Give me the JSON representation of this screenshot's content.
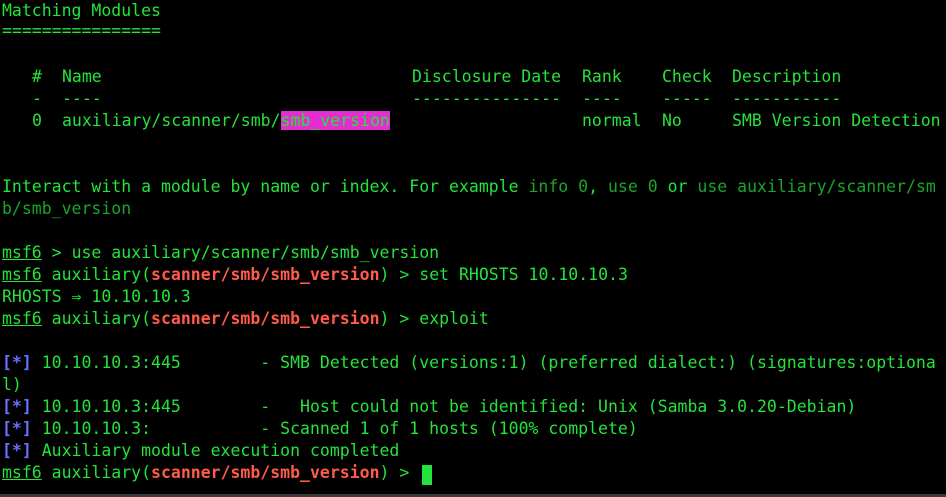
{
  "header": {
    "title": "Matching Modules",
    "underline": "================"
  },
  "table": {
    "headers": [
      "#",
      "Name",
      "Disclosure Date",
      "Rank",
      "Check",
      "Description"
    ],
    "underlines": [
      "-",
      "----",
      "---------------",
      "----",
      "-----",
      "-----------"
    ],
    "rows": [
      {
        "index": "0",
        "name_prefix": "auxiliary/scanner/smb/",
        "name_match": "smb_version",
        "date": "",
        "rank": "normal",
        "check": "No",
        "description": "SMB Version Detection"
      }
    ]
  },
  "hint": {
    "line1_a": "Interact with a module by name or index. For example ",
    "line1_b": "info 0",
    "line1_c": ", ",
    "line1_d": "use 0",
    "line1_e": " or ",
    "line1_f": "use auxiliary/scanner/sm",
    "line2": "b/smb_version"
  },
  "commands": [
    {
      "prompt": "msf6",
      "module": "",
      "command": "use auxiliary/scanner/smb/smb_version"
    },
    {
      "prompt": "msf6",
      "module": "scanner/smb/smb_version",
      "command": "set RHOSTS 10.10.10.3"
    },
    {
      "prompt": "msf6",
      "module": "scanner/smb/smb_version",
      "command": "exploit"
    },
    {
      "prompt": "msf6",
      "module": "scanner/smb/smb_version",
      "command": ""
    }
  ],
  "set_output": "RHOSTS ⇒ 10.10.10.3",
  "results": [
    {
      "marker": "[*]",
      "text": "10.10.10.3:445        - SMB Detected (versions:1) (preferred dialect:) (signatures:optiona",
      "cont": "l)"
    },
    {
      "marker": "[*]",
      "text": "10.10.10.3:445        -   Host could not be identified: Unix (Samba 3.0.20-Debian)"
    },
    {
      "marker": "[*]",
      "text": "10.10.10.3:           - Scanned 1 of 1 hosts (100% complete)"
    },
    {
      "marker": "[*]",
      "text": "Auxiliary module execution completed"
    }
  ],
  "colors": {
    "foreground": "#24e33a",
    "background": "#000000",
    "highlight": "#e42cd0",
    "module": "#ff5a4a",
    "marker": "#6a72ff"
  }
}
